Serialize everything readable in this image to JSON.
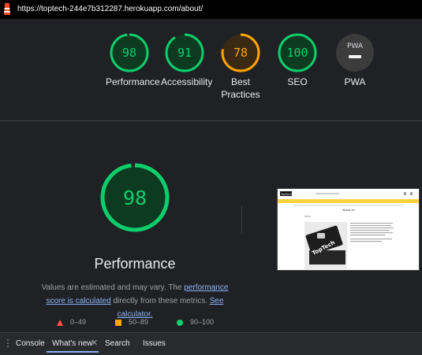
{
  "browser": {
    "url": "https://toptech-244e7b312287.herokuapp.com/about/"
  },
  "summary": [
    {
      "name": "Performance",
      "score": "98",
      "color": "#0cce6b"
    },
    {
      "name": "Accessibility",
      "score": "91",
      "color": "#0cce6b"
    },
    {
      "name": "Best Practices",
      "score": "78",
      "color": "#ffa400"
    },
    {
      "name": "SEO",
      "score": "100",
      "color": "#0cce6b"
    },
    {
      "name": "PWA",
      "score": "PWA",
      "color": "#9aa0a6"
    }
  ],
  "main": {
    "score": "98",
    "title": "Performance",
    "note_text_1": "Values are estimated and may vary. The ",
    "note_link_1": "performance score is calculated",
    "note_text_2": " directly from these metrics. ",
    "note_link_2": "See calculator."
  },
  "legend": [
    {
      "range": "0–49",
      "color": "#ff4e42",
      "shape": "triangle"
    },
    {
      "range": "50–89",
      "color": "#ffa400",
      "shape": "square"
    },
    {
      "range": "90–100",
      "color": "#0cce6b",
      "shape": "circle"
    }
  ],
  "thumbnail": {
    "brand": "TopTech",
    "heading": "About Us",
    "product_text": "TopTech"
  },
  "devtools": {
    "tabs": [
      "Console",
      "What's new",
      "Search",
      "Issues"
    ]
  }
}
